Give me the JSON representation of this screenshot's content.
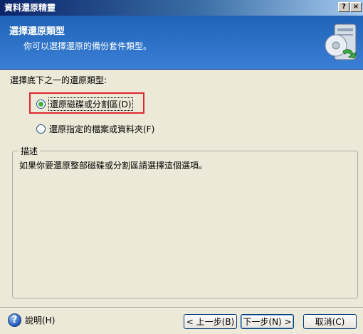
{
  "window": {
    "title": "資料還原精靈",
    "help_btn": "?",
    "close_btn": "×"
  },
  "header": {
    "title": "選擇還原類型",
    "subtitle": "你可以選擇還原的備份套件類型。"
  },
  "prompt": "選擇底下之一的還原類型:",
  "options": [
    {
      "label": "還原磁碟或分割區(D)",
      "selected": true
    },
    {
      "label": "還原指定的檔案或資料夾(F)",
      "selected": false
    }
  ],
  "description": {
    "legend": "描述",
    "text": "如果你要還原整部磁碟或分割區請選擇這個選項。"
  },
  "footer": {
    "help_label": "說明(H)",
    "help_icon": "?",
    "back_label": "< 上一步(B)",
    "next_label": "下一步(N) >",
    "cancel_label": "取消(C)"
  }
}
